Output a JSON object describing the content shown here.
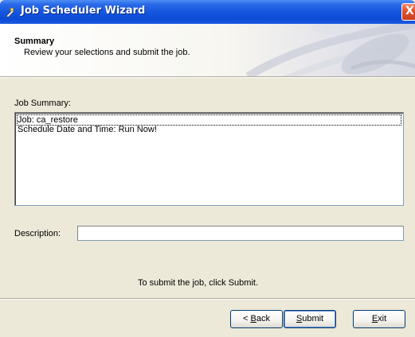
{
  "window": {
    "title": "Job Scheduler Wizard",
    "close_glyph": "X",
    "icon": "wizard-icon"
  },
  "header": {
    "title": "Summary",
    "subtitle": "Review your selections and submit the job."
  },
  "job_summary": {
    "label": "Job Summary:",
    "lines": [
      "Job: ca_restore",
      "Schedule Date and Time:  Run Now!"
    ]
  },
  "description": {
    "label": "Description:",
    "value": ""
  },
  "instruction": "To submit the job, click Submit.",
  "buttons": {
    "back": {
      "pre": "< ",
      "accel": "B",
      "rest": "ack"
    },
    "submit": {
      "pre": "",
      "accel": "S",
      "rest": "ubmit"
    },
    "exit": {
      "pre": "",
      "accel": "E",
      "rest": "xit"
    }
  }
}
